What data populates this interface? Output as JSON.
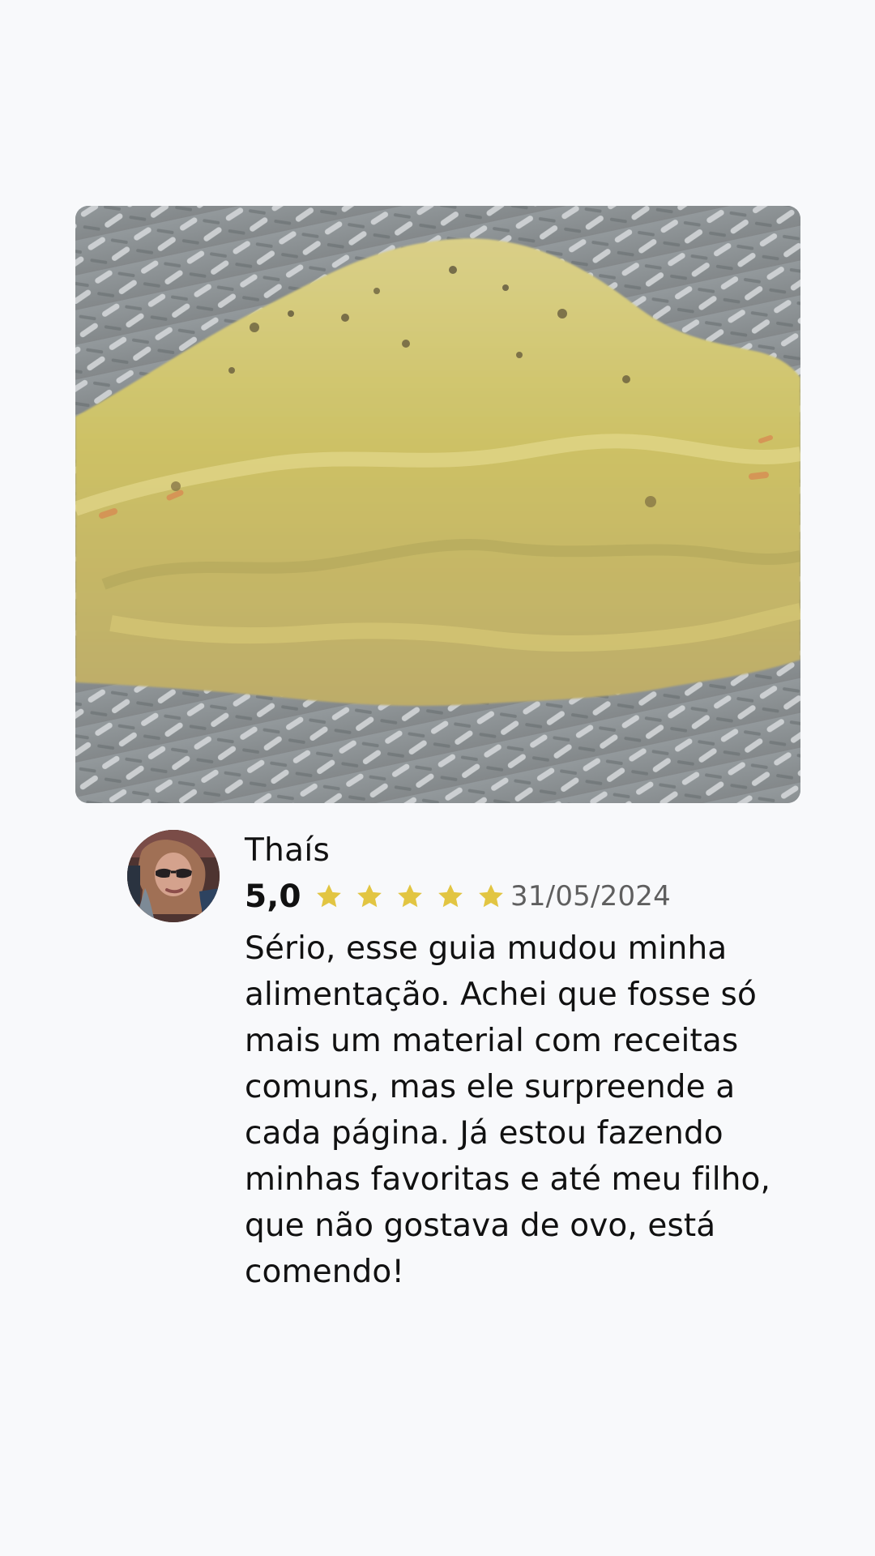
{
  "review": {
    "author": "Thaís",
    "rating_label": "5,0",
    "rating_value": 5,
    "rating_max": 5,
    "date": "31/05/2024",
    "text": "Sério, esse guia mudou minha alimentação. Achei que fosse só mais um material com receitas comuns, mas ele surpreende a cada página. Já estou fazendo minhas favoritas e até meu filho, que não gostava de ovo, está comendo!"
  },
  "colors": {
    "background": "#f8f9fb",
    "star": "#e2c542",
    "date": "#5f5f5f",
    "text": "#111111"
  },
  "icons": {
    "rating": "star-icon",
    "avatar": "avatar-photo",
    "photo": "food-photo"
  }
}
